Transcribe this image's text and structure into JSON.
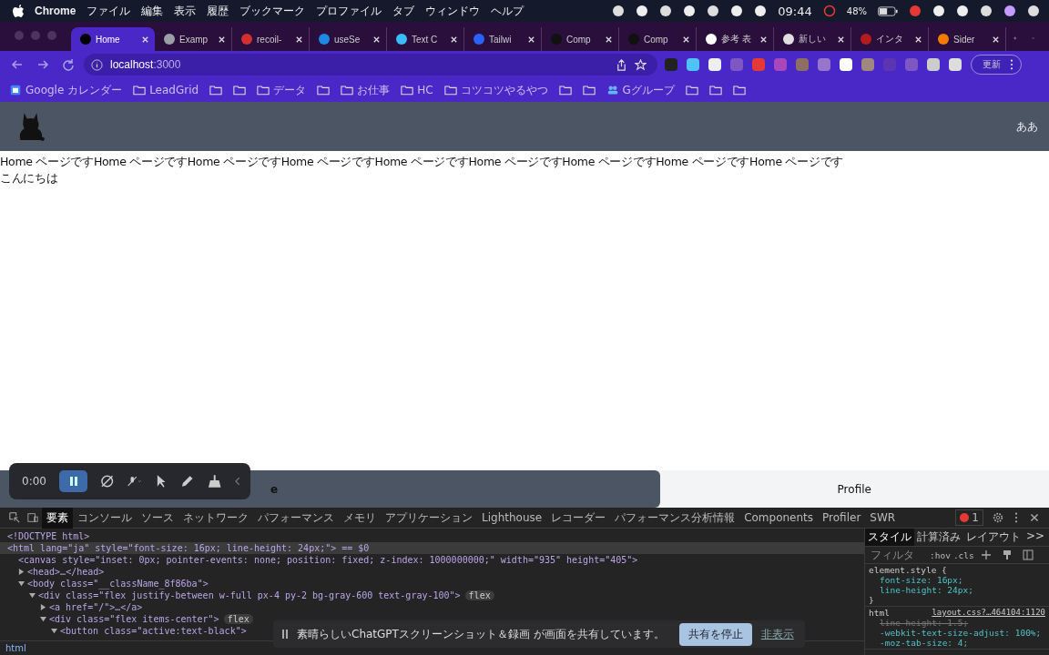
{
  "menubar": {
    "app": "Chrome",
    "menus": [
      "ファイル",
      "編集",
      "表示",
      "履歴",
      "ブックマーク",
      "プロファイル",
      "タブ",
      "ウィンドウ",
      "ヘルプ"
    ],
    "time": "09:44",
    "battery": "48%"
  },
  "tabs": [
    {
      "title": "Home",
      "selected": true,
      "color": "#000000"
    },
    {
      "title": "Examp",
      "selected": false,
      "color": "#9aa0a6"
    },
    {
      "title": "recoil-",
      "selected": false,
      "color": "#d32f2f"
    },
    {
      "title": "useSe",
      "selected": false,
      "color": "#1e88e5"
    },
    {
      "title": "Text C",
      "selected": false,
      "color": "#38bdf8"
    },
    {
      "title": "Tailwi",
      "selected": false,
      "color": "#2962ff"
    },
    {
      "title": "Comp",
      "selected": false,
      "color": "#111111"
    },
    {
      "title": "Comp",
      "selected": false,
      "color": "#111111"
    },
    {
      "title": "参考 表",
      "selected": false,
      "color": "#ffffff"
    },
    {
      "title": "新しい",
      "selected": false,
      "color": "#e0e0e0"
    },
    {
      "title": "インタ",
      "selected": false,
      "color": "#b71c1c"
    },
    {
      "title": "Sider",
      "selected": false,
      "color": "#f57c00"
    }
  ],
  "address": {
    "host": "localhost",
    "port": ":3000"
  },
  "update_button": "更新",
  "bookmarks": [
    {
      "kind": "app",
      "label": "Google カレンダー"
    },
    {
      "kind": "folder",
      "label": "LeadGrid"
    },
    {
      "kind": "folder"
    },
    {
      "kind": "folder"
    },
    {
      "kind": "folder",
      "label": "データ"
    },
    {
      "kind": "folder"
    },
    {
      "kind": "folder",
      "label": "お仕事"
    },
    {
      "kind": "folder",
      "label": "HC"
    },
    {
      "kind": "folder",
      "label": "コツコツやるやつ"
    },
    {
      "kind": "folder"
    },
    {
      "kind": "folder"
    },
    {
      "kind": "group",
      "label": "Gグループ"
    },
    {
      "kind": "folder"
    },
    {
      "kind": "folder"
    },
    {
      "kind": "folder"
    }
  ],
  "page": {
    "header_text": "ああ",
    "lines": [
      "Home ページですHome ページですHome ページですHome ページですHome ページですHome ページですHome ページですHome ページですHome ページです",
      "こんにちは"
    ],
    "nav": [
      {
        "label": "e",
        "selected": true
      },
      {
        "label": "Profile",
        "selected": false
      }
    ]
  },
  "recorder": {
    "time": "0:00"
  },
  "devtools": {
    "tabs": [
      {
        "label": "要素",
        "selected": true
      },
      {
        "label": "コンソール",
        "selected": false
      },
      {
        "label": "ソース",
        "selected": false
      },
      {
        "label": "ネットワーク",
        "selected": false
      },
      {
        "label": "パフォーマンス",
        "selected": false
      },
      {
        "label": "メモリ",
        "selected": false
      },
      {
        "label": "アプリケーション",
        "selected": false
      },
      {
        "label": "Lighthouse",
        "selected": false
      },
      {
        "label": "レコーダー",
        "selected": false
      },
      {
        "label": "パフォーマンス分析情報",
        "selected": false
      },
      {
        "label": "Components",
        "selected": false
      },
      {
        "label": "Profiler",
        "selected": false
      },
      {
        "label": "SWR",
        "selected": false
      }
    ],
    "errors": "1",
    "dom": [
      {
        "text": "<!DOCTYPE html>",
        "selected": false
      },
      {
        "text": "<html lang=\"ja\" style=\"font-size: 16px; line-height: 24px;\"> == $0",
        "selected": true,
        "children": [
          {
            "text": "<canvas style=\"inset: 0px; pointer-events: none; position: fixed; z-index: 1000000000;\" width=\"935\" height=\"405\">",
            "selected": false
          },
          {
            "text": "<head>…</head>",
            "selected": false,
            "expanded": false
          },
          {
            "text": "<body class=\"__className_8f86ba\">",
            "selected": false,
            "expanded": true,
            "children": [
              {
                "text": "<div class=\"flex justify-between w-full px-4 py-2 bg-gray-600 text-gray-100\">",
                "badge": "flex",
                "selected": false,
                "expanded": true,
                "children": [
                  {
                    "text": "<a href=\"/\">…</a>",
                    "selected": false,
                    "expanded": false
                  },
                  {
                    "text": "<div class=\"flex items-center\">",
                    "badge": "flex",
                    "selected": false,
                    "expanded": true,
                    "children": [
                      {
                        "text": "<button class=\"active:text-black\">",
                        "selected": false,
                        "expanded": true
                      }
                    ]
                  }
                ]
              }
            ]
          }
        ]
      }
    ],
    "breadcrumb": "html",
    "styles_tabs": [
      {
        "label": "スタイル",
        "selected": true
      },
      {
        "label": "計算済み",
        "selected": false
      },
      {
        "label": "レイアウト",
        "selected": false
      },
      {
        "label": ">>",
        "selected": false
      }
    ],
    "filter_placeholder": "フィルタ",
    "hov": ":hov",
    "cls": ".cls",
    "rules": [
      {
        "selector": "element.style {",
        "props": [
          {
            "text": "font-size: 16px;",
            "struck": false
          },
          {
            "text": "line-height: 24px;",
            "struck": false
          }
        ],
        "close": "}"
      },
      {
        "selector": "html",
        "source": "layout.css?…464104:1120",
        "props": [
          {
            "text": "line-height: 1.5;",
            "struck": true
          },
          {
            "text": "-webkit-text-size-adjust: 100%;",
            "struck": false
          },
          {
            "text": "-moz-tab-size: 4;",
            "struck": false
          }
        ]
      }
    ]
  },
  "share_banner": {
    "message": "素晴らしいChatGPTスクリーンショット＆録画 が画面を共有しています。",
    "stop": "共有を停止",
    "hide": "非表示"
  }
}
